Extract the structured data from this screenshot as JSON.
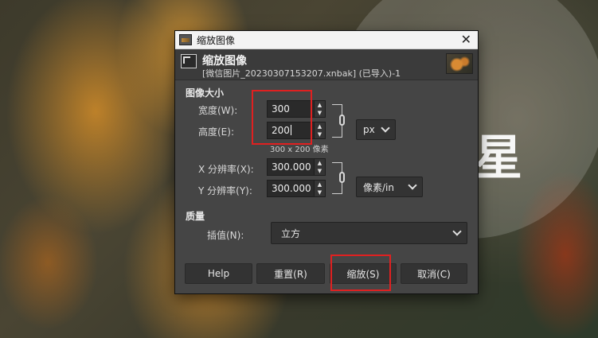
{
  "background": {
    "side_glyph": "星"
  },
  "window": {
    "title": "缩放图像",
    "close_glyph": "✕"
  },
  "header": {
    "title": "缩放图像",
    "subtitle": "[微信图片_20230307153207.xnbak] (已导入)-1"
  },
  "image_size": {
    "section_title": "图像大小",
    "width_label": "宽度(W):",
    "width_value": "300",
    "height_label": "高度(E):",
    "height_value": "200",
    "unit": "px",
    "size_note": "300 x 200 像素",
    "xres_label": "X 分辨率(X):",
    "xres_value": "300.000",
    "yres_label": "Y 分辨率(Y):",
    "yres_value": "300.000",
    "res_unit": "像素/in"
  },
  "quality": {
    "section_title": "质量",
    "interp_label": "插值(N):",
    "interp_value": "立方"
  },
  "buttons": {
    "help": "Help",
    "reset": "重置(R)",
    "scale": "缩放(S)",
    "cancel": "取消(C)"
  },
  "colors": {
    "highlight": "#e02020",
    "dialog_bg": "#454545"
  }
}
